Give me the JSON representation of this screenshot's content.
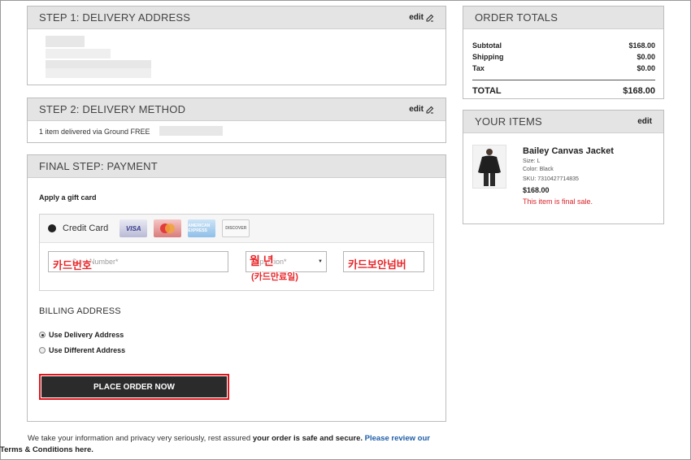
{
  "step1": {
    "title": "STEP 1: DELIVERY ADDRESS",
    "edit": "edit"
  },
  "step2": {
    "title": "STEP 2: DELIVERY METHOD",
    "edit": "edit",
    "method_text": "1 item delivered via Ground FREE"
  },
  "payment": {
    "title": "FINAL STEP: PAYMENT",
    "gift_card": "Apply a gift card",
    "credit_card_label": "Credit Card",
    "cards": [
      "VISA",
      "MasterCard",
      "AMERICAN EXPRESS",
      "DISCOVER"
    ],
    "card_number_placeholder": "Card Number*",
    "card_number_overlay": "카드번호",
    "expiration_placeholder": "Expiration*",
    "expiration_overlay": "월 년",
    "expiration_overlay_sub": "(카드만료일)",
    "cvv_overlay": "카드보안넘버",
    "billing_title": "BILLING ADDRESS",
    "billing_options": [
      {
        "label": "Use Delivery Address",
        "selected": true
      },
      {
        "label": "Use Different Address",
        "selected": false
      }
    ],
    "place_order": "PLACE ORDER NOW"
  },
  "footer": {
    "text1": "We take your information and privacy very seriously, rest assured ",
    "text2": "your order is safe and secure.",
    "link1": " Please review our",
    "link2": "Terms & Conditions here."
  },
  "totals": {
    "title": "ORDER TOTALS",
    "rows": [
      {
        "label": "Subtotal",
        "value": "$168.00"
      },
      {
        "label": "Shipping",
        "value": "$0.00"
      },
      {
        "label": "Tax",
        "value": "$0.00"
      }
    ],
    "total_label": "TOTAL",
    "total_value": "$168.00"
  },
  "items": {
    "title": "YOUR ITEMS",
    "edit": "edit",
    "name": "Bailey Canvas Jacket",
    "size": "Size: L",
    "color": "Color: Black",
    "sku": "SKU: 7310427714835",
    "price": "$168.00",
    "final_sale": "This item is final sale."
  },
  "colors": {
    "accent_red": "#e1141b",
    "link_blue": "#1d5da8",
    "button_dark": "#2b2b2b"
  }
}
